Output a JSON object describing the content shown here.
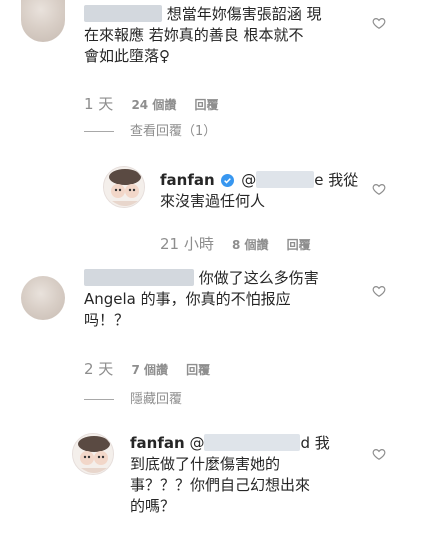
{
  "comments": [
    {
      "text_line1": "想當年妳傷害張韶涵 現",
      "text_line2": "在來報應 若妳真的善良 根本就不",
      "text_line3": "會如此墮落♀",
      "time": "1 天",
      "likes": "24 個讚",
      "reply_label": "回覆",
      "toggle_label": "查看回覆（1）",
      "reply": {
        "username": "fanfan",
        "mention_prefix": "@",
        "text_line1_end": "e 我從",
        "text_line2": "來沒害過任何人",
        "time": "21 小時",
        "likes": "8 個讚",
        "reply_label": "回覆"
      }
    },
    {
      "text_line1": "你做了这么多伤害",
      "text_line2": "Angela 的事，你真的不怕报应",
      "text_line3": "吗！？",
      "time": "2 天",
      "likes": "7 個讚",
      "reply_label": "回覆",
      "toggle_label": "隱藏回覆",
      "reply": {
        "username": "fanfan",
        "mention_prefix": "@",
        "text_line1_end": "d 我",
        "text_line2": "到底做了什麼傷害她的",
        "text_line3": "事？？？你們自己幻想出來",
        "text_line4": "的嗎？"
      }
    }
  ],
  "colors": {
    "verified": "#3897f0",
    "meta": "#8e8e8e",
    "text": "#262626"
  }
}
